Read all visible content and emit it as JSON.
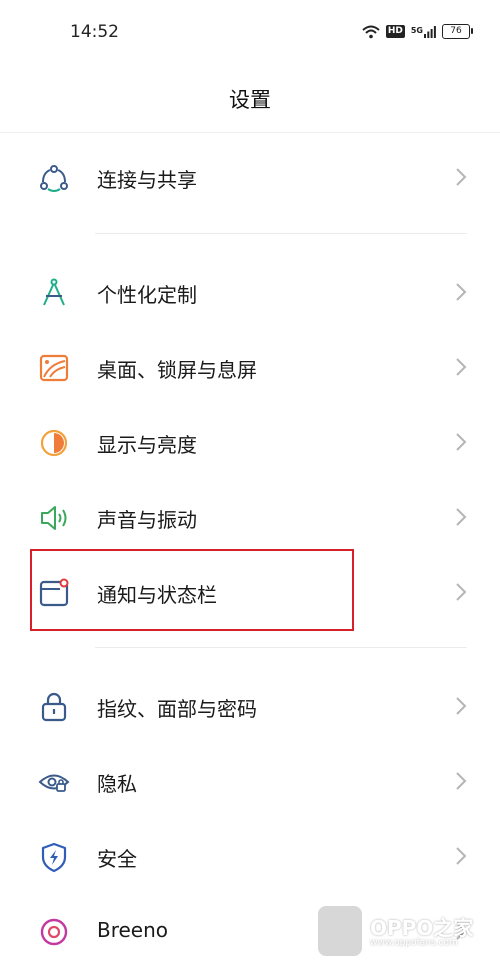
{
  "status_bar": {
    "time": "14:52",
    "hd_badge": "HD",
    "signal_type": "5G",
    "battery": "76",
    "icons": [
      "wifi-icon",
      "hd-icon",
      "5g-signal-icon",
      "battery-icon"
    ]
  },
  "header": {
    "title": "设置"
  },
  "settings": {
    "items": [
      {
        "label": "连接与共享",
        "icon": "share-nodes-icon",
        "color": "#3a5a8a"
      },
      {
        "label": "个性化定制",
        "icon": "compass-icon",
        "color": "#1fae8a"
      },
      {
        "label": "桌面、锁屏与息屏",
        "icon": "wallpaper-icon",
        "color": "#f07c3a"
      },
      {
        "label": "显示与亮度",
        "icon": "brightness-icon",
        "color": "#f3a13a"
      },
      {
        "label": "声音与振动",
        "icon": "speaker-icon",
        "color": "#3aa85a"
      },
      {
        "label": "通知与状态栏",
        "icon": "notification-icon",
        "color": "#3a5a8a",
        "accent": "#e03a3a"
      },
      {
        "label": "指纹、面部与密码",
        "icon": "lock-icon",
        "color": "#3a5a8a"
      },
      {
        "label": "隐私",
        "icon": "privacy-eye-icon",
        "color": "#3a5a8a"
      },
      {
        "label": "安全",
        "icon": "shield-icon",
        "color": "#2f5db8"
      },
      {
        "label": "Breeno",
        "icon": "breeno-icon",
        "color": "#c23aa0"
      }
    ]
  },
  "annotation": {
    "highlight_color": "#d6202c"
  },
  "watermark": {
    "brand": "OPPO之家",
    "url": "www.oppofans.com"
  }
}
